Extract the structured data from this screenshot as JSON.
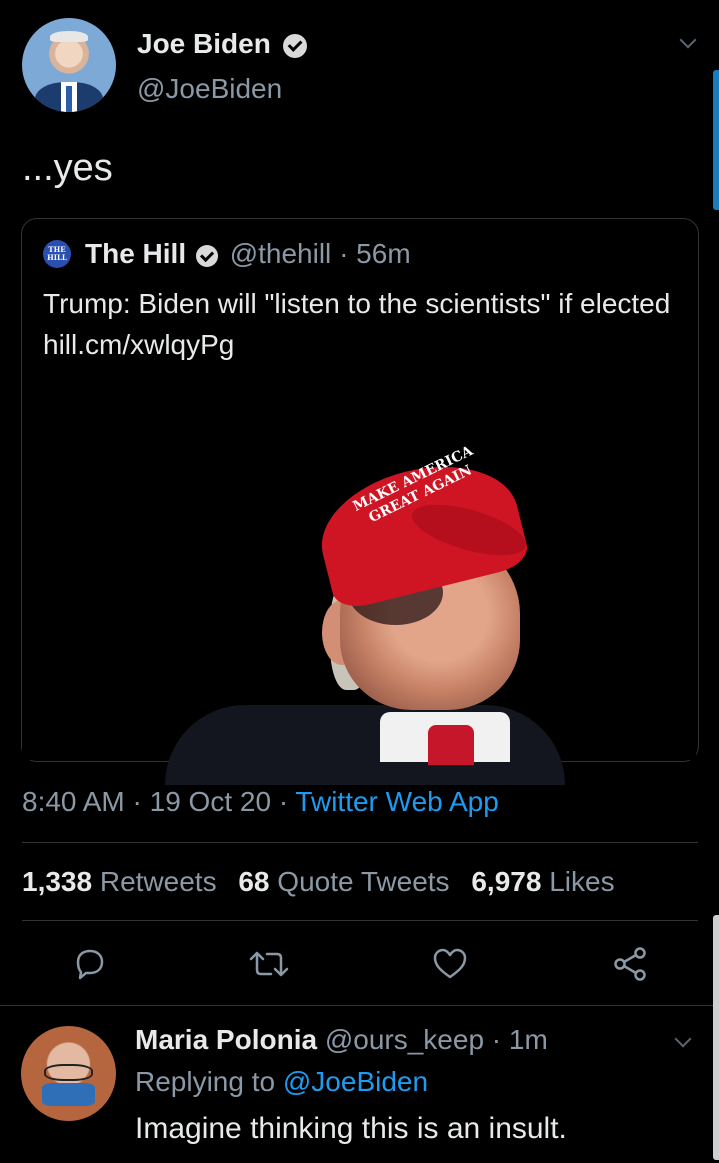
{
  "tweet": {
    "author_name": "Joe Biden",
    "author_handle": "@JoeBiden",
    "text": "...yes",
    "time": "8:40 AM",
    "date": "19 Oct 20",
    "source": "Twitter Web App",
    "separator": "·"
  },
  "quoted": {
    "logo_text_top": "THE",
    "logo_text_bottom": "HILL",
    "author_name": "The Hill",
    "author_handle": "@thehill",
    "age": "56m",
    "separator": "·",
    "text": "Trump: Biden will \"listen to the scientists\" if elected hill.cm/xwlqyPg",
    "image_cap_text": "MAKE AMERICA GREAT AGAIN"
  },
  "stats": {
    "retweets_count": "1,338",
    "retweets_label": "Retweets",
    "quotes_count": "68",
    "quotes_label": "Quote Tweets",
    "likes_count": "6,978",
    "likes_label": "Likes"
  },
  "actions": {
    "reply_icon": "reply-icon",
    "retweet_icon": "retweet-icon",
    "like_icon": "heart-icon",
    "share_icon": "share-icon"
  },
  "reply": {
    "author_name": "Maria Polonia",
    "author_handle": "@ours_keep",
    "age": "1m",
    "separator": "·",
    "replying_to_label": "Replying to",
    "replying_to_handle": "@JoeBiden",
    "text": "Imagine thinking this is an insult."
  },
  "colors": {
    "background": "#000000",
    "link": "#1d9bf0",
    "muted": "#8b98a5",
    "text": "#e7e9ea",
    "divider": "#2f3336"
  }
}
